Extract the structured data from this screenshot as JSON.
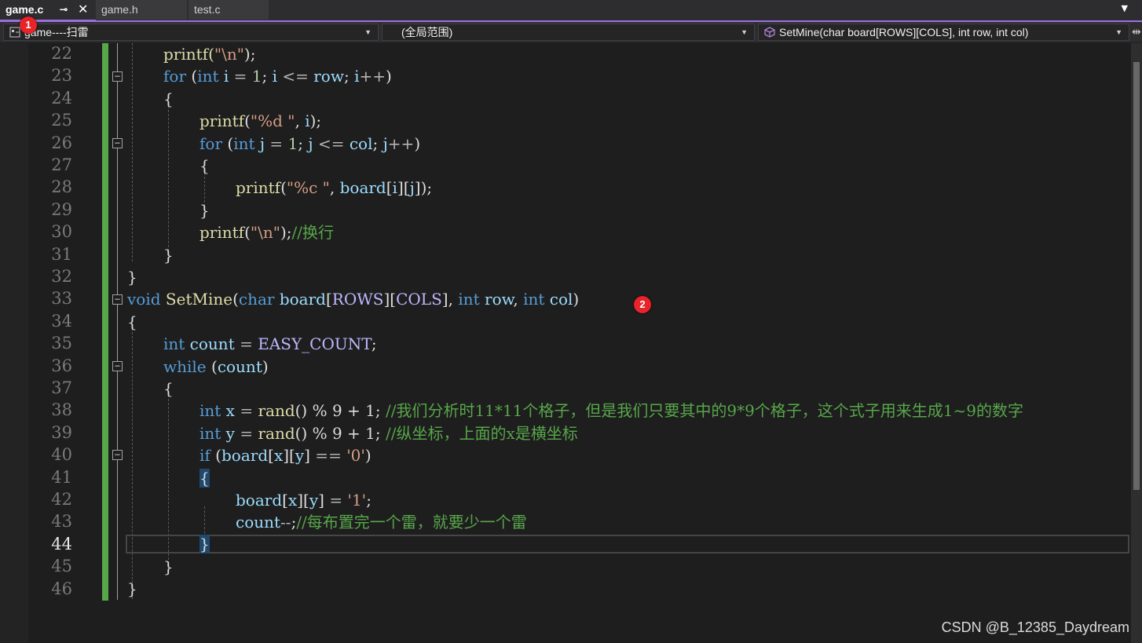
{
  "tabs": [
    {
      "label": "game.c",
      "active": true,
      "pin": "⊸",
      "close": "✕"
    },
    {
      "label": "game.h",
      "active": false
    },
    {
      "label": "test.c",
      "active": false
    }
  ],
  "navbar": {
    "project": "game----扫雷",
    "scope": "(全局范围)",
    "member": "SetMine(char board[ROWS][COLS], int row, int col)"
  },
  "badges": [
    "1",
    "2"
  ],
  "line_numbers": [
    "22",
    "23",
    "24",
    "25",
    "26",
    "27",
    "28",
    "29",
    "30",
    "31",
    "32",
    "33",
    "34",
    "35",
    "36",
    "37",
    "38",
    "39",
    "40",
    "41",
    "42",
    "43",
    "44",
    "45",
    "46"
  ],
  "current_line": "44",
  "code": {
    "l22": {
      "a": "printf(",
      "b": "\"\\n\"",
      "c": ");"
    },
    "l23": {
      "kw": "for",
      "p1": " (",
      "ty": "int",
      "v1": " i",
      "op1": " = ",
      "n1": "1",
      "s1": "; ",
      "v2": "i",
      "op2": " <= ",
      "v3": "row",
      "s2": "; ",
      "v4": "i",
      "op3": "++",
      "p2": ")"
    },
    "l24": "{",
    "l25": {
      "fn": "printf",
      "p1": "(",
      "str": "\"%d \"",
      "c": ", ",
      "v": "i",
      "end": ");"
    },
    "l26": {
      "kw": "for",
      "p1": " (",
      "ty": "int",
      "v1": " j",
      "op1": " = ",
      "n1": "1",
      "s1": "; ",
      "v2": "j",
      "op2": " <= ",
      "v3": "col",
      "s2": "; ",
      "v4": "j",
      "op3": "++",
      "p2": ")"
    },
    "l27": "{",
    "l28": {
      "fn": "printf",
      "p1": "(",
      "str": "\"%c \"",
      "c": ", ",
      "v1": "board",
      "b1": "[",
      "v2": "i",
      "b2": "][",
      "v3": "j",
      "b3": "]",
      "end": ");"
    },
    "l29": "}",
    "l30": {
      "fn": "printf",
      "p1": "(",
      "str": "\"\\n\"",
      "end": ");",
      "cm": "//换行"
    },
    "l31": "}",
    "l32": "}",
    "l33": {
      "ty": "void",
      "fn": " SetMine",
      "p1": "(",
      "t1": "char",
      "v1": " board",
      "b1": "[",
      "m1": "ROWS",
      "b2": "][",
      "m2": "COLS",
      "b3": "]",
      "c1": ", ",
      "t2": "int",
      "v2": " row",
      "c2": ", ",
      "t3": "int",
      "v3": " col",
      "p2": ")"
    },
    "l34": "{",
    "l35": {
      "ty": "int",
      "v": " count",
      "op": " = ",
      "m": "EASY_COUNT",
      "end": ";"
    },
    "l36": {
      "kw": "while",
      "p1": " (",
      "v": "count",
      "p2": ")"
    },
    "l37": "{",
    "l38": {
      "ty": "int",
      "v": " x",
      "op": " = ",
      "fn": "rand",
      "rest": "() % 9 + 1; ",
      "cm": "//我们分析时11*11个格子，但是我们只要其中的9*9个格子，这个式子用来生成1~9的数字"
    },
    "l39": {
      "ty": "int",
      "v": " y",
      "op": " = ",
      "fn": "rand",
      "rest": "() % 9 + 1; ",
      "cm": "//纵坐标，上面的x是横坐标"
    },
    "l40": {
      "kw": "if",
      "p1": " (",
      "v1": "board",
      "b1": "[",
      "v2": "x",
      "b2": "][",
      "v3": "y",
      "b3": "]",
      "op": " == ",
      "str": "'0'",
      "p2": ")"
    },
    "l41": "{",
    "l42": {
      "v1": "board",
      "b1": "[",
      "v2": "x",
      "b2": "][",
      "v3": "y",
      "b3": "]",
      "op": " = ",
      "str": "'1'",
      "end": ";"
    },
    "l43": {
      "v": "count",
      "op": "--",
      "end": ";",
      "cm": "//每布置完一个雷，就要少一个雷"
    },
    "l44": "}",
    "l45": "}",
    "l46": "}"
  },
  "watermark": "CSDN @B_12385_Daydream",
  "colors": {
    "accent": "#9b6fe0",
    "change_bar": "#57a64a",
    "badge": "#e8232a",
    "keyword": "#569cd6",
    "comment": "#57a64a"
  }
}
